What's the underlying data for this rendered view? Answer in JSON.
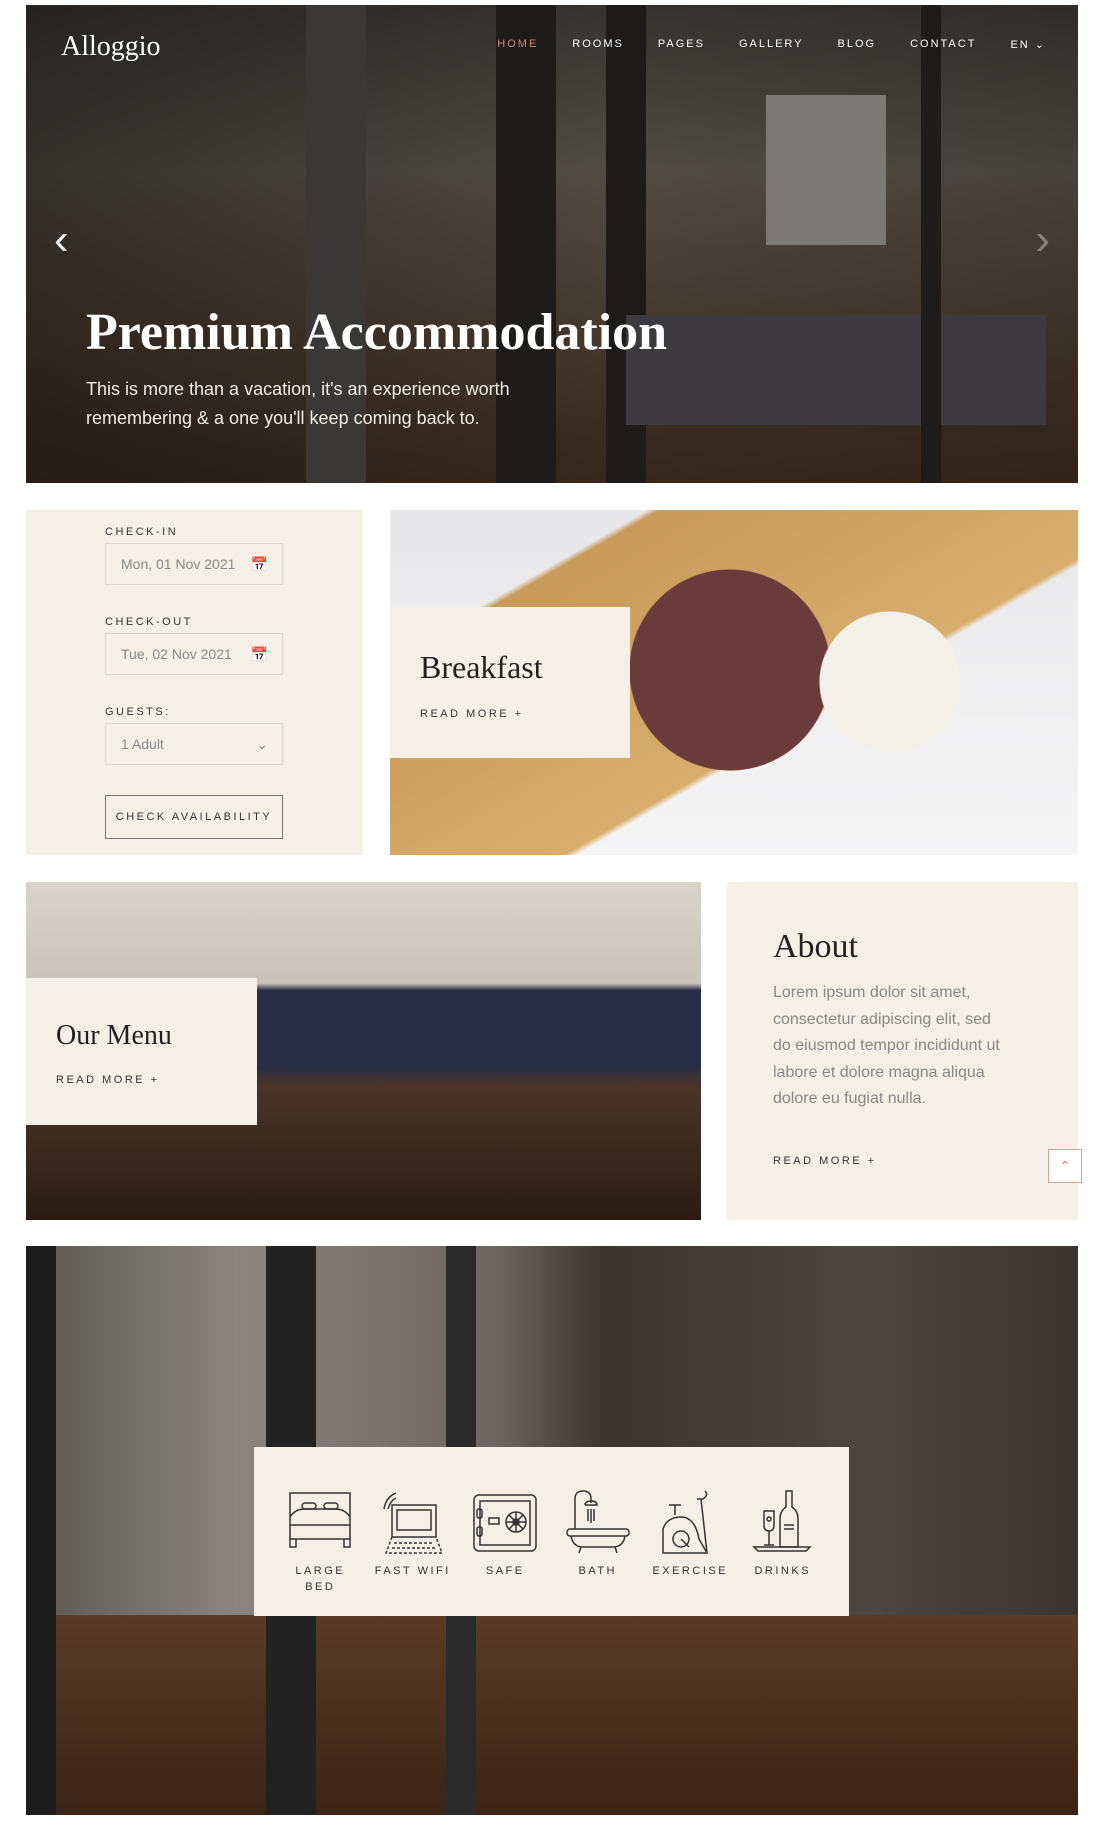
{
  "header": {
    "logo": "Alloggio",
    "nav": [
      "HOME",
      "ROOMS",
      "PAGES",
      "GALLERY",
      "BLOG",
      "CONTACT"
    ],
    "lang": "EN",
    "active_color": "#c98a72"
  },
  "hero": {
    "title": "Premium Accommodation",
    "subtitle": "This is more than a vacation, it's an experience worth remembering & a one you'll keep coming back to."
  },
  "booking": {
    "checkin_label": "CHECK-IN",
    "checkin_value": "Mon, 01 Nov 2021",
    "checkout_label": "CHECK-OUT",
    "checkout_value": "Tue, 02 Nov 2021",
    "guests_label": "GUESTS:",
    "guests_value": "1 Adult",
    "button": "CHECK AVAILABILITY"
  },
  "breakfast": {
    "title": "Breakfast",
    "link": "READ MORE +"
  },
  "menu": {
    "title": "Our Menu",
    "link": "READ MORE +"
  },
  "about": {
    "title": "About",
    "text": "Lorem ipsum dolor sit amet, consectetur adipiscing elit, sed do eiusmod tempor incididunt ut labore et dolore magna aliqua dolore eu fugiat nulla.",
    "link": "READ MORE +"
  },
  "amenities": [
    {
      "label": "LARGE BED",
      "icon": "bed-icon"
    },
    {
      "label": "FAST WIFI",
      "icon": "laptop-wifi-icon"
    },
    {
      "label": "SAFE",
      "icon": "safe-icon"
    },
    {
      "label": "BATH",
      "icon": "bathtub-icon"
    },
    {
      "label": "EXERCISE",
      "icon": "exercise-bike-icon"
    },
    {
      "label": "DRINKS",
      "icon": "drinks-icon"
    }
  ],
  "colors": {
    "cream": "#f4f0e8",
    "accent": "#c98a72"
  }
}
